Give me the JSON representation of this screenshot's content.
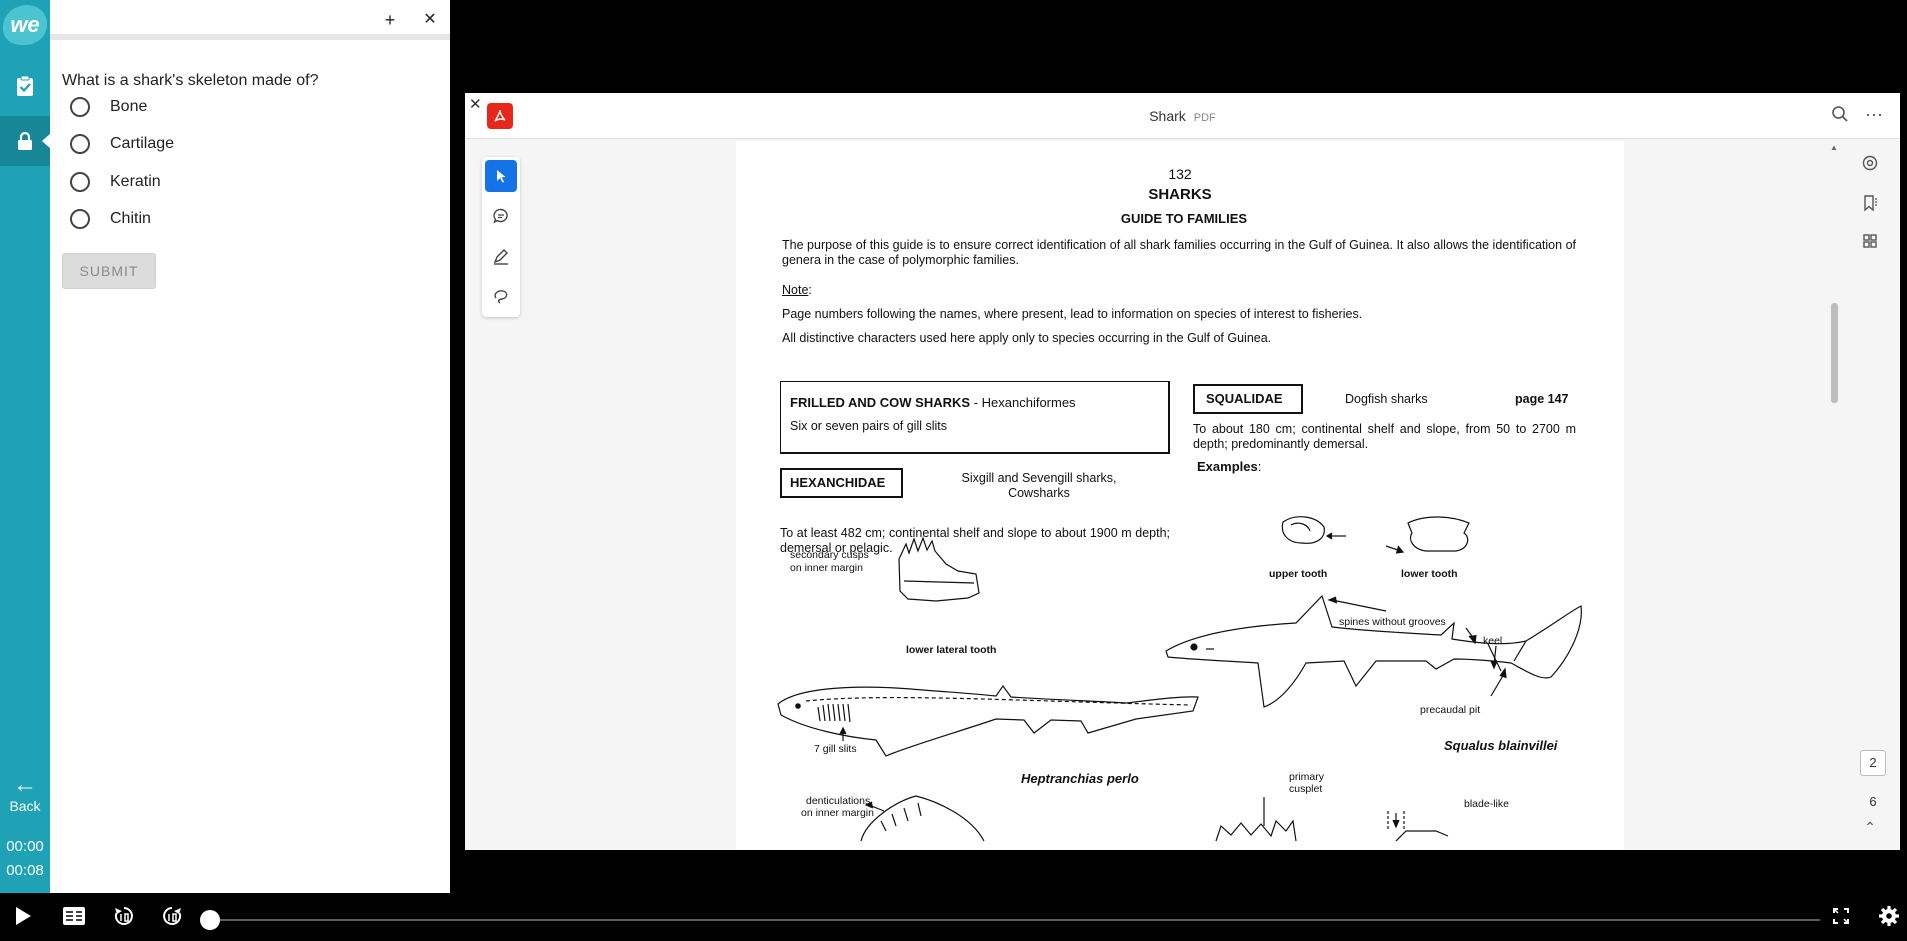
{
  "rail": {
    "logo": "we",
    "back_label": "Back",
    "time_elapsed": "00:00",
    "time_total": "00:08"
  },
  "quiz": {
    "question": "What is a shark's skeleton made of?",
    "options": [
      "Bone",
      "Cartilage",
      "Keratin",
      "Chitin"
    ],
    "submit_label": "SUBMIT",
    "add_symbol": "+",
    "close_symbol": "✕"
  },
  "video": {
    "progress": 0.0
  },
  "pdf": {
    "title": "Shark",
    "ext": "PDF",
    "current_page": "2",
    "total_pages": "6",
    "content": {
      "page_number": "132",
      "heading": "SHARKS",
      "subheading": "GUIDE TO FAMILIES",
      "intro": "The purpose of this guide is to ensure correct identification of all shark families occurring in the Gulf of Guinea. It also allows the identification of genera in the case of polymorphic families.",
      "note_label": "Note",
      "note_colon": ":",
      "note_1": "Page numbers following the names, where present, lead to information on species of interest to fisheries.",
      "note_2": "All distinctive characters used here apply only to species occurring in the Gulf of Guinea.",
      "frilled_title": "FRILLED AND COW SHARKS",
      "frilled_sub": " - Hexanchiformes",
      "frilled_desc": "Six or seven pairs of gill slits",
      "hexanchidae": "HEXANCHIDAE",
      "hexanchidae_common": "Sixgill and Sevengill sharks, Cowsharks",
      "hexanchidae_desc": "To at least 482 cm; continental shelf and slope to about 1900 m depth; demersal or pelagic.",
      "squalidae": "SQUALIDAE",
      "squalidae_common": "Dogfish sharks",
      "squalidae_page": "page 147",
      "squalidae_desc": "To about 180 cm; continental shelf and slope, from 50 to 2700 m depth; predominantly demersal.",
      "examples": "Examples",
      "examples_colon": ":",
      "label_secondary_cusps": "secondary cusps",
      "label_inner_margin": "on inner margin",
      "label_lower_lateral_tooth": "lower lateral tooth",
      "label_gill_slits": "7 gill slits",
      "label_heptranchias": "Heptranchias perlo",
      "label_denticulations": "denticulations",
      "label_denticulations_margin": "on inner margin",
      "label_upper_tooth": "upper tooth",
      "label_lower_tooth": "lower tooth",
      "label_spines": "spines without grooves",
      "label_keel": "keel",
      "label_precaudal": "precaudal pit",
      "label_squalus": "Squalus blainvillei",
      "label_primary": "primary",
      "label_cusplet": "cusplet",
      "label_blade": "blade-like"
    }
  }
}
